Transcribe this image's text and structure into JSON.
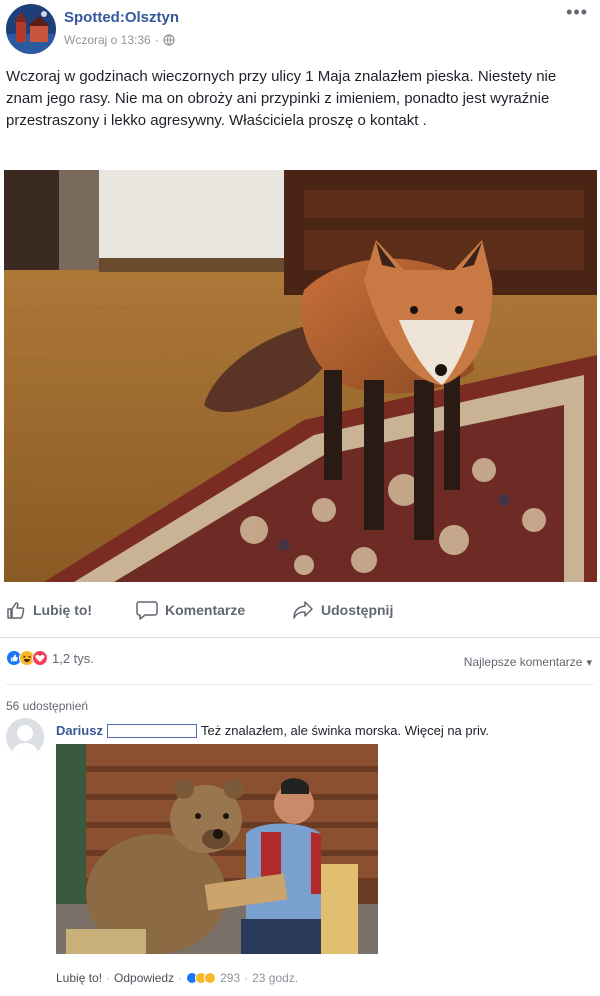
{
  "post": {
    "page_name": "Spotted:Olsztyn",
    "timestamp": "Wczoraj o 13:36",
    "separator": "·",
    "more_icon": "•••",
    "text": "Wczoraj w godzinach wieczornych przy ulicy 1 Maja znalazłem pieska. Niestety nie znam jego rasy. Nie ma on obroży ani przypinki z imieniem, ponadto jest wyraźnie przestraszony i lekko agresywny. Właściciela proszę o kontakt ."
  },
  "actions": {
    "like": "Lubię to!",
    "comment": "Komentarze",
    "share": "Udostępnij"
  },
  "reactions": {
    "count": "1,2 tys.",
    "types": [
      "like",
      "haha",
      "love"
    ],
    "colors": {
      "like": "#1877f2",
      "haha": "#f7b928",
      "love": "#f33e58"
    }
  },
  "comments_sort": {
    "label": "Najlepsze komentarze",
    "caret": "▾"
  },
  "shares": "56 udostępnień",
  "comment": {
    "author": "Dariusz",
    "text": "Też znalazłem, ale świnka morska. Więcej na priv.",
    "like": "Lubię to!",
    "sep": "·",
    "reply": "Odpowiedz",
    "reaction_count": "293",
    "time": "23 godz."
  }
}
